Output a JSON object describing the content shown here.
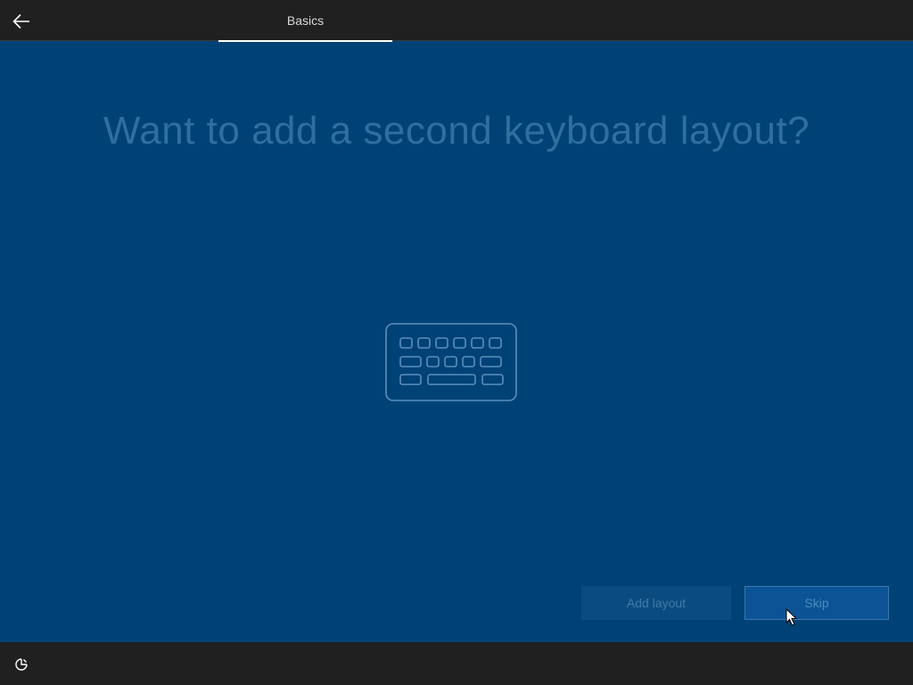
{
  "header": {
    "back_icon": "arrow-left-icon",
    "tab_label": "Basics"
  },
  "main": {
    "heading": "Want to add a second keyboard layout?",
    "illustration_icon": "keyboard-icon"
  },
  "buttons": {
    "add_layout_label": "Add layout",
    "skip_label": "Skip"
  },
  "footer": {
    "accessibility_icon": "ease-of-access-icon"
  },
  "colors": {
    "background": "#004275",
    "bar": "#202020",
    "heading": "#2e6fa0",
    "icon_stroke": "#5a8fbf"
  }
}
